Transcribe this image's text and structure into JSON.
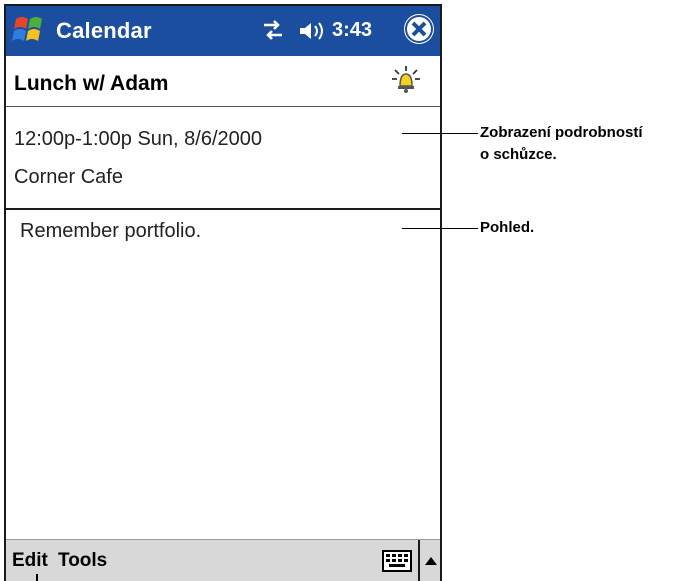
{
  "titlebar": {
    "app_title": "Calendar",
    "time": "3:43",
    "start_icon": "windows-flag-icon",
    "connectivity_icon": "connectivity-icon",
    "volume_icon": "volume-icon",
    "close_icon": "close-icon"
  },
  "appointment": {
    "subject": "Lunch w/ Adam",
    "alarm_icon": "alarm-bell-icon",
    "datetime": "12:00p-1:00p Sun, 8/6/2000",
    "location": "Corner Cafe",
    "notes": "Remember portfolio."
  },
  "menubar": {
    "edit": "Edit",
    "tools": "Tools",
    "keyboard_icon": "keyboard-icon",
    "sip_arrow_icon": "up-arrow-icon"
  },
  "callouts": {
    "details": [
      "Zobrazení podrobností",
      "o schůzce."
    ],
    "view": "Pohled."
  },
  "colors": {
    "titlebar": "#1c4ea0",
    "menubar": "#d8d8d8"
  }
}
